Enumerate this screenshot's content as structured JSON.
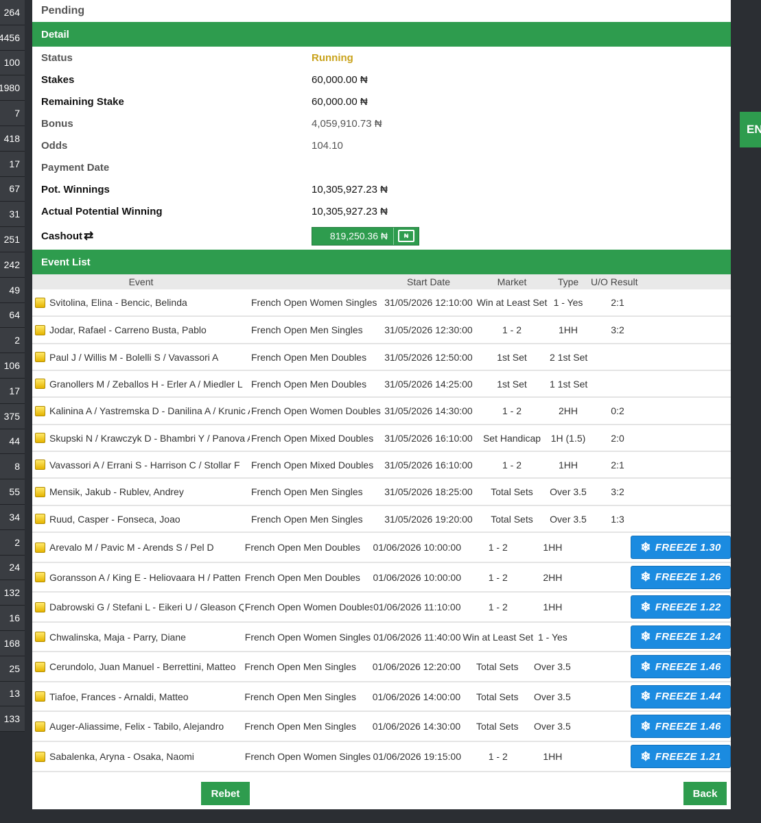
{
  "left_numbers": [
    "264",
    "4456",
    "100",
    "1980",
    "7",
    "418",
    "17",
    "67",
    "31",
    "251",
    "242",
    "49",
    "64",
    "2",
    "106",
    "17",
    "375",
    "44",
    "8",
    "55",
    "34",
    "2",
    "24",
    "132",
    "16",
    "168",
    "25",
    "13",
    "133"
  ],
  "lang_tab": "EN",
  "pending": "Pending",
  "detail": {
    "title": "Detail",
    "status_label": "Status",
    "status_value": "Running",
    "stakes_label": "Stakes",
    "stakes_value": "60,000.00 ₦",
    "remaining_label": "Remaining Stake",
    "remaining_value": "60,000.00 ₦",
    "bonus_label": "Bonus",
    "bonus_value": "4,059,910.73 ₦",
    "odds_label": "Odds",
    "odds_value": "104.10",
    "payment_label": "Payment Date",
    "payment_value": "",
    "pot_label": "Pot. Winnings",
    "pot_value": "10,305,927.23 ₦",
    "actual_label": "Actual Potential Winning",
    "actual_value": "10,305,927.23 ₦",
    "cashout_label": "Cashout",
    "cashout_value": "819,250.36 ₦",
    "cashout_icon": "₦"
  },
  "event_list": {
    "title": "Event List",
    "headers": {
      "event": "Event",
      "start_date": "Start Date",
      "market": "Market",
      "type": "Type",
      "result": "U/O Result"
    },
    "freeze_label": "FREEZE",
    "rows": [
      {
        "event": "Svitolina, Elina - Bencic, Belinda",
        "tournament": "French Open Women Singles",
        "date": "31/05/2026 12:10:00",
        "market": "Win at Least Set",
        "type": "1 - Yes",
        "result": "2:1",
        "freeze": ""
      },
      {
        "event": "Jodar, Rafael - Carreno Busta, Pablo",
        "tournament": "French Open Men Singles",
        "date": "31/05/2026 12:30:00",
        "market": "1 - 2",
        "type": "1HH",
        "result": "3:2",
        "freeze": ""
      },
      {
        "event": "Paul J / Willis M - Bolelli S / Vavassori A",
        "tournament": "French Open Men Doubles",
        "date": "31/05/2026 12:50:00",
        "market": "1st Set",
        "type": "2 1st Set",
        "result": "",
        "freeze": ""
      },
      {
        "event": "Granollers M / Zeballos H - Erler A / Miedler L",
        "tournament": "French Open Men Doubles",
        "date": "31/05/2026 14:25:00",
        "market": "1st Set",
        "type": "1 1st Set",
        "result": "",
        "freeze": ""
      },
      {
        "event": "Kalinina A / Yastremska D - Danilina A / Krunic A",
        "tournament": "French Open Women Doubles",
        "date": "31/05/2026 14:30:00",
        "market": "1 - 2",
        "type": "2HH",
        "result": "0:2",
        "freeze": ""
      },
      {
        "event": "Skupski N / Krawczyk D - Bhambri Y / Panova A",
        "tournament": "French Open Mixed Doubles",
        "date": "31/05/2026 16:10:00",
        "market": "Set Handicap",
        "type": "1H (1.5)",
        "result": "2:0",
        "freeze": ""
      },
      {
        "event": "Vavassori A / Errani S - Harrison C / Stollar F",
        "tournament": "French Open Mixed Doubles",
        "date": "31/05/2026 16:10:00",
        "market": "1 - 2",
        "type": "1HH",
        "result": "2:1",
        "freeze": ""
      },
      {
        "event": "Mensik, Jakub - Rublev, Andrey",
        "tournament": "French Open Men Singles",
        "date": "31/05/2026 18:25:00",
        "market": "Total Sets",
        "type": "Over 3.5",
        "result": "3:2",
        "freeze": ""
      },
      {
        "event": "Ruud, Casper - Fonseca, Joao",
        "tournament": "French Open Men Singles",
        "date": "31/05/2026 19:20:00",
        "market": "Total Sets",
        "type": "Over 3.5",
        "result": "1:3",
        "freeze": ""
      },
      {
        "event": "Arevalo M / Pavic M - Arends S / Pel D",
        "tournament": "French Open Men Doubles",
        "date": "01/06/2026 10:00:00",
        "market": "1 - 2",
        "type": "1HH",
        "result": "",
        "freeze": "1.30"
      },
      {
        "event": "Goransson A / King E - Heliovaara H / Patten H",
        "tournament": "French Open Men Doubles",
        "date": "01/06/2026 10:00:00",
        "market": "1 - 2",
        "type": "2HH",
        "result": "",
        "freeze": "1.26"
      },
      {
        "event": "Dabrowski G / Stefani L - Eikeri U / Gleason Q",
        "tournament": "French Open Women Doubles",
        "date": "01/06/2026 11:10:00",
        "market": "1 - 2",
        "type": "1HH",
        "result": "",
        "freeze": "1.22"
      },
      {
        "event": "Chwalinska, Maja - Parry, Diane",
        "tournament": "French Open Women Singles",
        "date": "01/06/2026 11:40:00",
        "market": "Win at Least Set",
        "type": "1 - Yes",
        "result": "",
        "freeze": "1.24"
      },
      {
        "event": "Cerundolo, Juan Manuel - Berrettini, Matteo",
        "tournament": "French Open Men Singles",
        "date": "01/06/2026 12:20:00",
        "market": "Total Sets",
        "type": "Over 3.5",
        "result": "",
        "freeze": "1.46"
      },
      {
        "event": "Tiafoe, Frances - Arnaldi, Matteo",
        "tournament": "French Open Men Singles",
        "date": "01/06/2026 14:00:00",
        "market": "Total Sets",
        "type": "Over 3.5",
        "result": "",
        "freeze": "1.44"
      },
      {
        "event": "Auger-Aliassime, Felix - Tabilo, Alejandro",
        "tournament": "French Open Men Singles",
        "date": "01/06/2026 14:30:00",
        "market": "Total Sets",
        "type": "Over 3.5",
        "result": "",
        "freeze": "1.46"
      },
      {
        "event": "Sabalenka, Aryna - Osaka, Naomi",
        "tournament": "French Open Women Singles",
        "date": "01/06/2026 19:15:00",
        "market": "1 - 2",
        "type": "1HH",
        "result": "",
        "freeze": "1.21"
      }
    ]
  },
  "buttons": {
    "rebet": "Rebet",
    "back": "Back"
  },
  "colors": {
    "green": "#2e9c4e",
    "running": "#c9a21a",
    "freeze_blue": "#1b8be0"
  }
}
